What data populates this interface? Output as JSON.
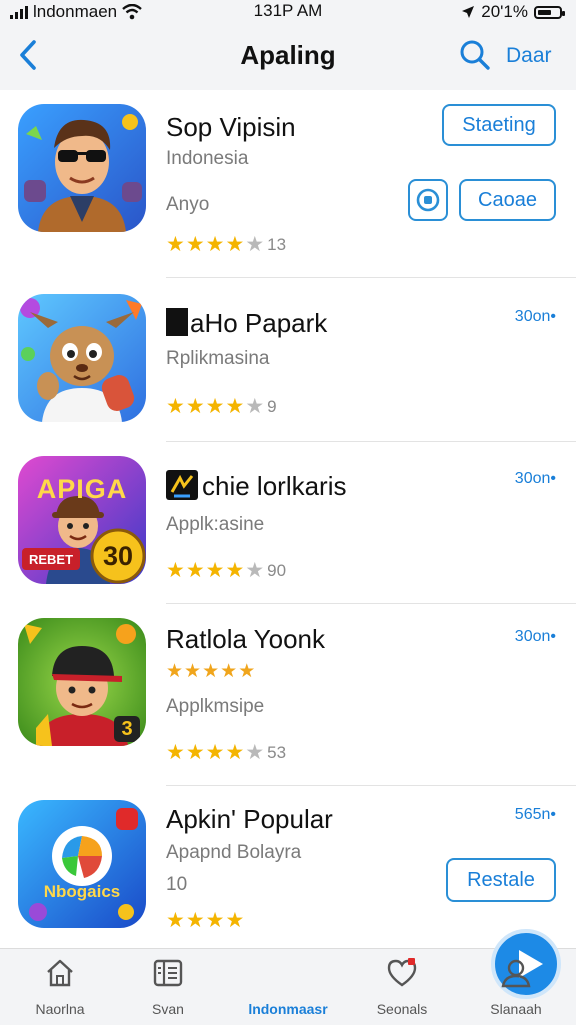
{
  "status_bar": {
    "carrier": "lndonmaen",
    "time": "131P AM",
    "battery": "20'1%",
    "icons": [
      "signal-icon",
      "wifi-icon",
      "location-arrow-icon",
      "battery-icon"
    ]
  },
  "nav": {
    "title": "Apaling",
    "action_label": "Daar",
    "icons": [
      "back-chevron-icon",
      "search-icon"
    ]
  },
  "apps": [
    {
      "name": "Sop Vipisin",
      "subtitle": "Indonesia",
      "subtitle2": "Anyo",
      "rating": 4,
      "rating_count": "13",
      "primary_button": "Staeting",
      "secondary_button": "Caoae"
    },
    {
      "name": "aHo Papark",
      "subtitle": "Rplikmasina",
      "rating": 4,
      "rating_count": "9",
      "price": "30on•"
    },
    {
      "name": "chie lorlkaris",
      "subtitle": "Applk:asine",
      "rating": 4,
      "rating_count": "90",
      "price": "30on•",
      "icon_text": "APIGA",
      "icon_number": "30",
      "icon_banner": "REBET"
    },
    {
      "name": "Ratlola Yoonk",
      "subtitle": "Applkmsipe",
      "rating": 4,
      "rating_count": "53",
      "price": "30on•",
      "icon_badge": "3"
    },
    {
      "name": "Apkin' Popular",
      "subtitle": "Apapnd Bolayra",
      "subtitle2": "10",
      "rating": 4,
      "price": "565n•",
      "primary_button": "Restale",
      "icon_text": "Nbogaics"
    }
  ],
  "tabs": [
    {
      "label": "Naorlna",
      "icon": "home-icon"
    },
    {
      "label": "Svan",
      "icon": "list-icon"
    },
    {
      "label": "lndonmaasr",
      "icon": "play-icon",
      "active": true
    },
    {
      "label": "Seonals",
      "icon": "heart-icon"
    },
    {
      "label": "Slanaah",
      "icon": "person-icon"
    }
  ],
  "colors": {
    "accent": "#1a7fd8",
    "star": "#f4b400",
    "bar_background": "#f3f4f6"
  }
}
